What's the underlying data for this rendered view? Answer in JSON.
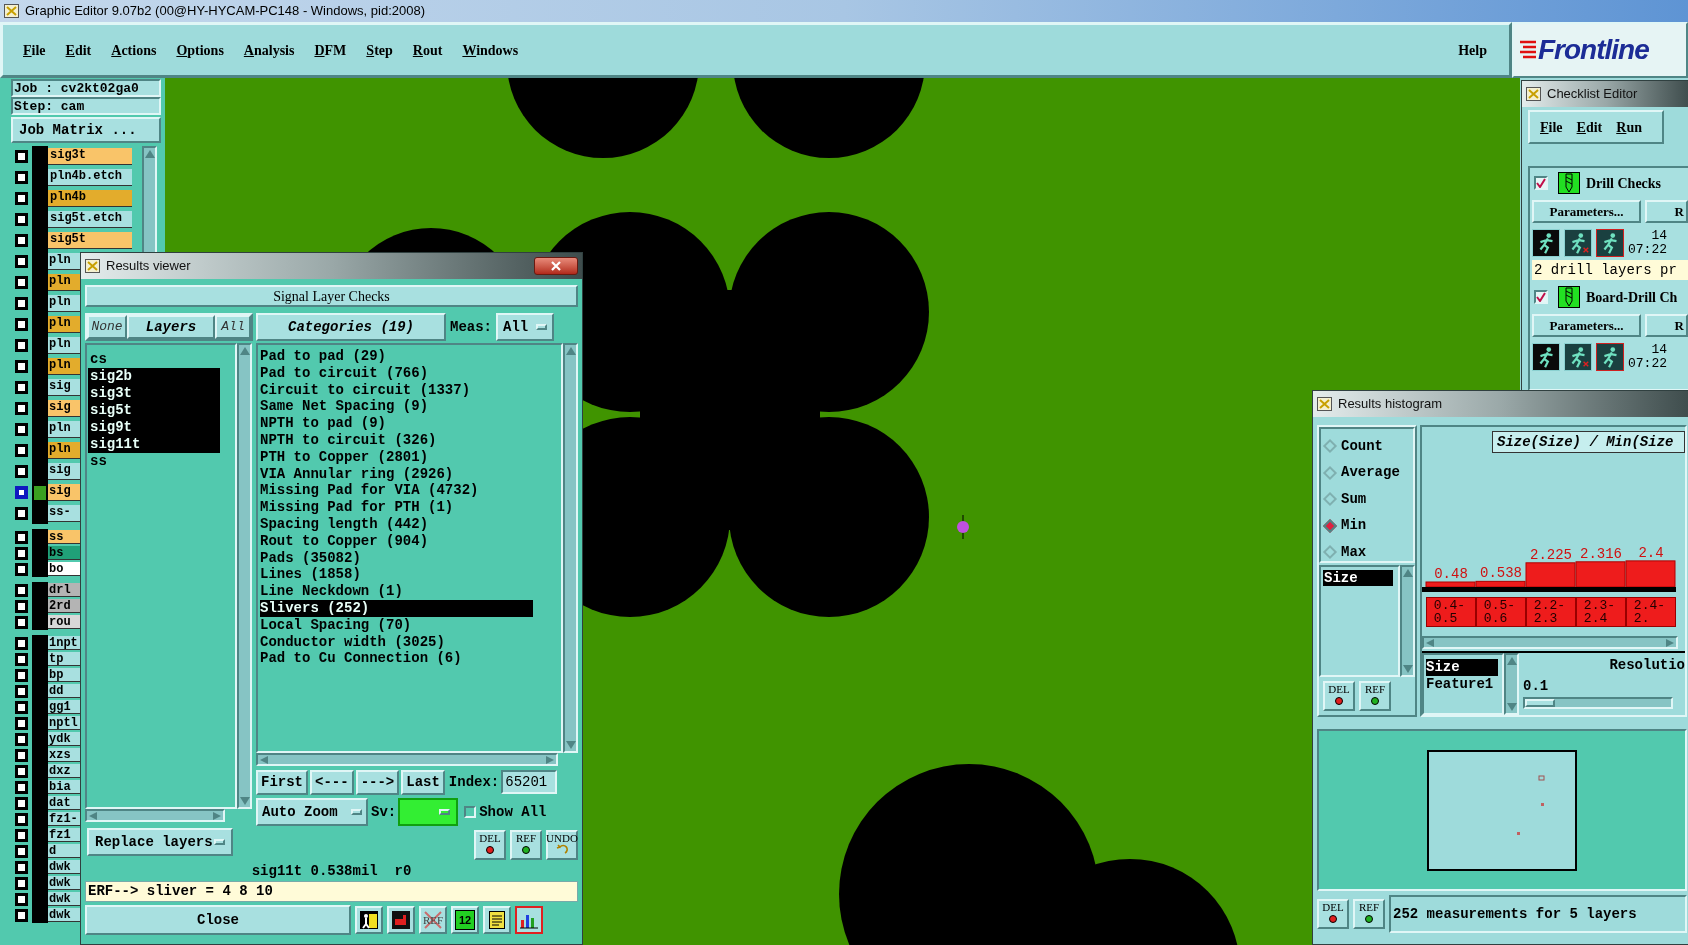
{
  "window": {
    "title": "Graphic Editor 9.07b2 (00@HY-HYCAM-PC148 - Windows, pid:2008)"
  },
  "menu": {
    "items": [
      "File",
      "Edit",
      "Actions",
      "Options",
      "Analysis",
      "DFM",
      "Step",
      "Rout",
      "Windows"
    ],
    "help": "Help"
  },
  "logo": {
    "text": "Frontline"
  },
  "job": {
    "job": "Job : cv2kt02ga0",
    "step": "Step: cam",
    "matrix_button": "Job Matrix ..."
  },
  "layer_groups": [
    {
      "layers": [
        {
          "name": "sig3t",
          "color": "#f9c469",
          "selected": false
        },
        {
          "name": "pln4b.etch",
          "color": "#a8e0e0",
          "selected": false
        },
        {
          "name": "pln4b",
          "color": "#e3ac2c",
          "selected": false
        },
        {
          "name": "sig5t.etch",
          "color": "#a8e0e0",
          "selected": false
        },
        {
          "name": "sig5t",
          "color": "#f9c469",
          "selected": false
        },
        {
          "name": "pln",
          "color": "#a8e0e0",
          "selected": false
        },
        {
          "name": "pln",
          "color": "#e3ac2c",
          "selected": false
        },
        {
          "name": "pln",
          "color": "#a8e0e0",
          "selected": false
        },
        {
          "name": "pln",
          "color": "#e3ac2c",
          "selected": false
        },
        {
          "name": "pln",
          "color": "#a8e0e0",
          "selected": false
        },
        {
          "name": "pln",
          "color": "#e3ac2c",
          "selected": false
        },
        {
          "name": "sig",
          "color": "#a8e0e0",
          "selected": false
        },
        {
          "name": "sig",
          "color": "#f9c469",
          "selected": false
        },
        {
          "name": "pln",
          "color": "#a8e0e0",
          "selected": false
        },
        {
          "name": "pln",
          "color": "#e3ac2c",
          "selected": false
        },
        {
          "name": "sig",
          "color": "#a8e0e0",
          "selected": false
        },
        {
          "name": "sig",
          "color": "#f9c469",
          "selected": true
        },
        {
          "name": "ss-",
          "color": "#a8e0e0",
          "selected": false
        }
      ]
    },
    {
      "layers": [
        {
          "name": "ss",
          "color": "#f9c469",
          "selected": false
        },
        {
          "name": "bs",
          "color": "#20a078",
          "selected": false
        },
        {
          "name": "bo",
          "color": "#ffffff",
          "selected": false
        }
      ]
    },
    {
      "layers": [
        {
          "name": "drl",
          "color": "#b4b4b4",
          "selected": false
        },
        {
          "name": "2rd",
          "color": "#b4b4b4",
          "selected": false
        },
        {
          "name": "rou",
          "color": "#d8d8d8",
          "selected": false
        }
      ]
    },
    {
      "layers": [
        {
          "name": "1npt",
          "color": "#a8e0e0",
          "selected": false
        },
        {
          "name": "tp",
          "color": "#a8e0e0",
          "selected": false
        },
        {
          "name": "bp",
          "color": "#a8e0e0",
          "selected": false
        },
        {
          "name": "dd",
          "color": "#a8e0e0",
          "selected": false
        },
        {
          "name": "gg1",
          "color": "#a8e0e0",
          "selected": false
        },
        {
          "name": "nptl",
          "color": "#a8e0e0",
          "selected": false
        },
        {
          "name": "ydk",
          "color": "#a8e0e0",
          "selected": false
        },
        {
          "name": "xzs",
          "color": "#a8e0e0",
          "selected": false
        },
        {
          "name": "dxz",
          "color": "#a8e0e0",
          "selected": false
        },
        {
          "name": "bia",
          "color": "#a8e0e0",
          "selected": false
        },
        {
          "name": "dat",
          "color": "#a8e0e0",
          "selected": false
        },
        {
          "name": "fz1-",
          "color": "#a8e0e0",
          "selected": false
        },
        {
          "name": "fz1",
          "color": "#a8e0e0",
          "selected": false
        },
        {
          "name": "d",
          "color": "#a8e0e0",
          "selected": false
        },
        {
          "name": "dwk",
          "color": "#a8e0e0",
          "selected": false
        },
        {
          "name": "dwk",
          "color": "#a8e0e0",
          "selected": false
        },
        {
          "name": "dwk",
          "color": "#a8e0e0",
          "selected": false
        },
        {
          "name": "dwk",
          "color": "#a8e0e0",
          "selected": false
        }
      ]
    }
  ],
  "results_viewer": {
    "title": "Results viewer",
    "heading": "Signal Layer Checks",
    "none_button": "None",
    "layers_button": "Layers",
    "all_button": "All",
    "categories_button": "Categories (19)",
    "meas_label": "Meas:",
    "meas_value": "All",
    "layers": [
      {
        "name": "cs",
        "selected": false
      },
      {
        "name": "sig2b",
        "selected": true
      },
      {
        "name": "sig3t",
        "selected": true
      },
      {
        "name": "sig5t",
        "selected": true
      },
      {
        "name": "sig9t",
        "selected": true
      },
      {
        "name": "sig11t",
        "selected": true
      },
      {
        "name": "ss",
        "selected": false
      }
    ],
    "categories": [
      {
        "label": "Pad to pad (29)",
        "selected": false
      },
      {
        "label": "Pad to circuit (766)",
        "selected": false
      },
      {
        "label": "Circuit to circuit (1337)",
        "selected": false
      },
      {
        "label": "Same Net Spacing (9)",
        "selected": false
      },
      {
        "label": "NPTH to pad (9)",
        "selected": false
      },
      {
        "label": "NPTH to circuit (326)",
        "selected": false
      },
      {
        "label": "PTH to Copper (2801)",
        "selected": false
      },
      {
        "label": "VIA Annular ring (2926)",
        "selected": false
      },
      {
        "label": "Missing Pad for VIA (4732)",
        "selected": false
      },
      {
        "label": "Missing Pad for PTH (1)",
        "selected": false
      },
      {
        "label": "Spacing length (442)",
        "selected": false
      },
      {
        "label": "Rout to Copper (904)",
        "selected": false
      },
      {
        "label": "Pads (35082)",
        "selected": false
      },
      {
        "label": "Lines (1858)",
        "selected": false
      },
      {
        "label": "Line Neckdown (1)",
        "selected": false
      },
      {
        "label": "Slivers (252)",
        "selected": true
      },
      {
        "label": "Local Spacing (70)",
        "selected": false
      },
      {
        "label": "Conductor width (3025)",
        "selected": false
      },
      {
        "label": "Pad to Cu Connection (6)",
        "selected": false
      }
    ],
    "nav": [
      "First",
      "<---",
      "--->",
      "Last"
    ],
    "index_label": "Index:",
    "index_value": "65201",
    "auto_zoom": "Auto Zoom",
    "sv_label": "Sv:",
    "show_all": {
      "label": "Show All",
      "checked": false
    },
    "replace_layers": "Replace layers",
    "tool_buttons": [
      {
        "label": "DEL",
        "kind": "del"
      },
      {
        "label": "REF",
        "kind": "ref"
      },
      {
        "label": "UNDO",
        "kind": "undo"
      }
    ],
    "status": "sig11t 0.538mil  r0",
    "erf": "ERF--> sliver = 4 8 10",
    "close": "Close",
    "bottom_icons": [
      {
        "kind": "figure",
        "selected": false
      },
      {
        "kind": "monitor",
        "selected": false
      },
      {
        "kind": "ref_off",
        "label": "REF",
        "selected": false
      },
      {
        "kind": "numbers",
        "label": "12",
        "selected": false
      },
      {
        "kind": "notes",
        "selected": false
      },
      {
        "kind": "chart",
        "selected": true
      }
    ]
  },
  "checklist_editor": {
    "title": "Checklist Editor",
    "menu": [
      "File",
      "Edit",
      "Run"
    ],
    "checks": [
      {
        "name": "Drill Checks",
        "checked": true,
        "parameters": "Parameters...",
        "button_2": "R",
        "count": "14",
        "time": "07:22",
        "message": "2 drill layers pr"
      },
      {
        "name": "Board-Drill Ch",
        "checked": true,
        "parameters": "Parameters...",
        "button_2": "R",
        "count": "14",
        "time": "07:22"
      }
    ]
  },
  "histogram": {
    "title": "Results histogram",
    "modes": [
      {
        "label": "Count",
        "selected": false
      },
      {
        "label": "Average",
        "selected": false
      },
      {
        "label": "Sum",
        "selected": false
      },
      {
        "label": "Min",
        "selected": true
      },
      {
        "label": "Max",
        "selected": false
      }
    ],
    "fields": [
      {
        "label": "Size",
        "selected": true
      }
    ],
    "field_buttons": [
      {
        "label": "DEL",
        "kind": "del"
      },
      {
        "label": "REF",
        "kind": "ref"
      }
    ],
    "chart_data": {
      "type": "bar",
      "title": "Size(Size) / Min(Size",
      "categories": [
        "0.4-0.5",
        "0.5-0.6",
        "2.2-2.3",
        "2.3-2.4",
        "2.4-2."
      ],
      "values": [
        0.48,
        0.538,
        2.225,
        2.316,
        2.4
      ],
      "data_labels": true
    },
    "features": [
      {
        "label": "Size",
        "selected": true
      },
      {
        "label": "Feature1",
        "selected": false
      }
    ],
    "resolution": {
      "label": "Resolutio",
      "value": "0.1",
      "level": 0
    },
    "bottom_buttons": [
      {
        "label": "DEL",
        "kind": "del"
      },
      {
        "label": "REF",
        "kind": "ref"
      }
    ],
    "summary": "252 measurements for 5 layers"
  }
}
